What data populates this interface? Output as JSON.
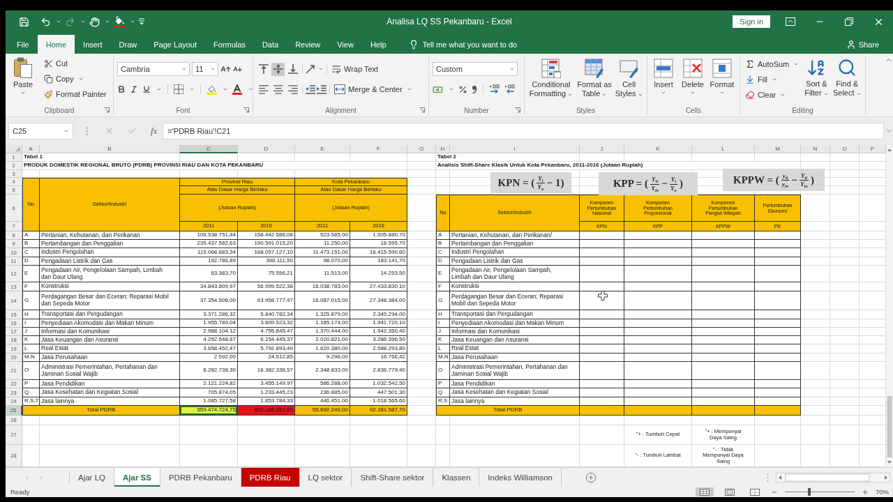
{
  "window": {
    "title": "Analisa LQ SS Pekanbaru - Excel",
    "sign_in": "Sign in"
  },
  "ribbon_tabs": [
    {
      "label": "File",
      "selected": false
    },
    {
      "label": "Home",
      "selected": true
    },
    {
      "label": "Insert",
      "selected": false
    },
    {
      "label": "Draw",
      "selected": false
    },
    {
      "label": "Page Layout",
      "selected": false
    },
    {
      "label": "Formulas",
      "selected": false
    },
    {
      "label": "Data",
      "selected": false
    },
    {
      "label": "Review",
      "selected": false
    },
    {
      "label": "View",
      "selected": false
    },
    {
      "label": "Help",
      "selected": false
    }
  ],
  "tell_me": {
    "placeholder": "Tell me what you want to do"
  },
  "share": "Share",
  "ribbon": {
    "clipboard": {
      "label": "Clipboard",
      "paste": "Paste",
      "cut": "Cut",
      "copy": "Copy",
      "format_painter": "Format Painter"
    },
    "font": {
      "label": "Font",
      "name": "Cambria",
      "size": "11"
    },
    "alignment": {
      "label": "Alignment",
      "vertical": [
        {
          "kind": "top",
          "selected": false
        },
        {
          "kind": "middle",
          "selected": true
        },
        {
          "kind": "bottom",
          "selected": false
        }
      ],
      "horizontal": [
        {
          "kind": "left",
          "selected": false
        },
        {
          "kind": "center",
          "selected": false
        },
        {
          "kind": "right",
          "selected": false
        }
      ],
      "wrap_text": "Wrap Text",
      "merge_center": "Merge & Center"
    },
    "number": {
      "label": "Number",
      "format": "Custom"
    },
    "styles": {
      "label": "Styles",
      "buttons": [
        {
          "kind": "conditional",
          "label": "Conditional Formatting"
        },
        {
          "kind": "table",
          "label": "Format as Table"
        },
        {
          "kind": "cell_styles",
          "label": "Cell Styles"
        }
      ]
    },
    "cells": {
      "label": "Cells",
      "buttons": [
        {
          "kind": "insert",
          "label": "Insert"
        },
        {
          "kind": "delete",
          "label": "Delete"
        },
        {
          "kind": "format",
          "label": "Format"
        }
      ]
    },
    "editing": {
      "label": "Editing",
      "autosum": "AutoSum",
      "fill": "Fill",
      "clear": "Clear",
      "sort_filter": "Sort & Filter",
      "find_select": "Find & Select"
    }
  },
  "formula_bar": {
    "name_box": "C25",
    "function_label": "fx",
    "formula": "='PDRB Riau'!C21"
  },
  "columns": [
    {
      "label": "A",
      "selected": false
    },
    {
      "label": "B",
      "selected": false
    },
    {
      "label": "C",
      "selected": true
    },
    {
      "label": "D",
      "selected": false
    },
    {
      "label": "E",
      "selected": false
    },
    {
      "label": "F",
      "selected": false
    },
    {
      "label": "G",
      "selected": false
    },
    {
      "label": "H",
      "selected": false
    },
    {
      "label": "I",
      "selected": false
    },
    {
      "label": "J",
      "selected": false
    },
    {
      "label": "K",
      "selected": false
    },
    {
      "label": "L",
      "selected": false
    },
    {
      "label": "M",
      "selected": false
    },
    {
      "label": "N",
      "selected": false
    },
    {
      "label": "O",
      "selected": false
    },
    {
      "label": "P",
      "selected": false
    }
  ],
  "rows": [
    {
      "label": "1",
      "selected": false
    },
    {
      "label": "2",
      "selected": false
    },
    {
      "label": "3",
      "selected": false
    },
    {
      "label": "4",
      "selected": false
    },
    {
      "label": "5",
      "selected": false
    },
    {
      "label": "6",
      "selected": false
    },
    {
      "label": "7",
      "selected": false
    },
    {
      "label": "8",
      "selected": false
    },
    {
      "label": "9",
      "selected": false
    },
    {
      "label": "10",
      "selected": false
    },
    {
      "label": "11",
      "selected": false
    },
    {
      "label": "12",
      "selected": false
    },
    {
      "label": "13",
      "selected": false
    },
    {
      "label": "14",
      "selected": false
    },
    {
      "label": "15",
      "selected": false
    },
    {
      "label": "16",
      "selected": false
    },
    {
      "label": "17",
      "selected": false
    },
    {
      "label": "18",
      "selected": false
    },
    {
      "label": "19",
      "selected": false
    },
    {
      "label": "20",
      "selected": false
    },
    {
      "label": "21",
      "selected": false
    },
    {
      "label": "22",
      "selected": false
    },
    {
      "label": "23",
      "selected": false
    },
    {
      "label": "24",
      "selected": false
    },
    {
      "label": "25",
      "selected": true
    },
    {
      "label": "26",
      "selected": false
    },
    {
      "label": "27",
      "selected": false
    },
    {
      "label": "28",
      "selected": false
    }
  ],
  "table_1": {
    "title": "Tabel 1",
    "subtitle": "PRODUK DOMESTIK REGIONAL BRUTO (PDRB) PROVINSI RIAU DAN KOTA PEKANBARU",
    "header": {
      "no": "No",
      "sector": "Sektor/Industri",
      "groups": [
        {
          "region": "Provinsi Riau",
          "basis": "Atas Dasar Harga Berlaku",
          "unit": "(Jutaan Rupiah)",
          "years": [
            "2011",
            "2016"
          ]
        },
        {
          "region": "Kota Pekanbaru",
          "basis": "Atas Dasar Harga Berlaku",
          "unit": "(Jutaan Rupiah)",
          "years": [
            "2011",
            "2016"
          ]
        }
      ]
    },
    "rows": [
      {
        "code": "A",
        "sector": "Pertanian, Kehutanan, dan Perikanan",
        "values": [
          "106.538.751,44",
          "158.442.586,08",
          "523.585,00",
          "1.505.880,70"
        ]
      },
      {
        "code": "B",
        "sector": "Pertambangan dan Penggalian",
        "values": [
          "235.437.582,63",
          "190.591.015,20",
          "11.250,00",
          "18.595,70"
        ]
      },
      {
        "code": "C",
        "sector": "Industri Pengolahan",
        "values": [
          "115.068.683,34",
          "168.057.127,10",
          "11.473.151,00",
          "16.415.590,60"
        ]
      },
      {
        "code": "D",
        "sector": "Pengadaan Listrik dan Gas",
        "values": [
          "192.786,89",
          "396.111,50",
          "98.070,00",
          "183.141,70"
        ]
      },
      {
        "code": "E",
        "sector": "Pengadaan Air, Pengelolaan Sampah, Limbah dan Daur Ulang",
        "values": [
          "63.383,70",
          "75.556,21",
          "11.513,00",
          "14.253,50"
        ]
      },
      {
        "code": "F",
        "sector": "Konstruksi",
        "values": [
          "34.843.609,97",
          "56.999.522,38",
          "16.038.783,00",
          "27.433.830,10"
        ]
      },
      {
        "code": "G",
        "sector": "Perdagangan Besar dan Eceran; Reparasi Mobil dan Sepeda Motor",
        "values": [
          "37.354.506,00",
          "63.958.777,47",
          "16.087.015,00",
          "27.348.384,00"
        ]
      },
      {
        "code": "H",
        "sector": "Transportasi dan Pergudangan",
        "values": [
          "3.371.286,32",
          "5.840.782,34",
          "1.325.879,00",
          "2.345.294,00"
        ]
      },
      {
        "code": "I",
        "sector": "Penyediaan Akomodasi dan Makan Minum",
        "values": [
          "1.955.789,04",
          "3.609.523,32",
          "1.185.174,00",
          "1.941.720,10"
        ]
      },
      {
        "code": "J",
        "sector": "Informasi dan Komunikasi",
        "values": [
          "2.988.104,12",
          "4.755.845,47",
          "1.370.444,00",
          "1.942.350,40"
        ]
      },
      {
        "code": "K",
        "sector": "Jasa Keuangan dan Asuransi",
        "values": [
          "4.252.648,67",
          "6.154.445,37",
          "2.020.821,00",
          "3.286.396,50"
        ]
      },
      {
        "code": "L",
        "sector": "Real Estat",
        "values": [
          "3.658.452,47",
          "5.792.893,49",
          "1.620.380,00",
          "2.588.293,80"
        ]
      },
      {
        "code": "M,N",
        "sector": "Jasa Perusahaan",
        "values": [
          "2.592,00",
          "24.512,85",
          "9.296,00",
          "16.756,42"
        ]
      },
      {
        "code": "O",
        "sector": "Administrasi Pemerintahan, Pertahanan dan Jaminan Sosial Wajib",
        "values": [
          "8.282.738,30",
          "16.382.336,57",
          "2.348.833,00",
          "2.836.779,40"
        ]
      },
      {
        "code": "P",
        "sector": "Jasa Pendidikan",
        "values": [
          "2.121.224,82",
          "3.455.149,97",
          "586.288,00",
          "1.032.542,50"
        ]
      },
      {
        "code": "Q",
        "sector": "Jasa Kesehatan dan Kegiatan Sosial",
        "values": [
          "705.874,05",
          "1.233.445,23",
          "236.885,00",
          "447.501,30"
        ]
      },
      {
        "code": "R,S,T",
        "sector": "Jasa lainnya",
        "values": [
          "1.085.727,58",
          "1.853.784,33",
          "446.451,00",
          "1.018.565,60"
        ]
      }
    ],
    "total": {
      "label": "Total PDRB",
      "cells": [
        {
          "value": "559.474.724,75",
          "color": "#e3f03c",
          "selected": true
        },
        {
          "value": "802.188.397,05",
          "color": "#e2141b",
          "selected": false
        },
        {
          "value": "55.692.240,00",
          "color": "#f5be00",
          "selected": false
        },
        {
          "value": "92.381.587,70",
          "color": "#f5be00",
          "selected": false
        }
      ]
    }
  },
  "table_2": {
    "title": "Tabel 2",
    "subtitle": "Analisis Shift-Share Klasik Untuk Kota Pekanbaru, 2011-2016 (Jutaan Rupiah)",
    "header": {
      "no": "No",
      "sector": "Sektor/Industri",
      "components": [
        {
          "name": "Komponen Pertumbuhan Nasional",
          "abbr": "KPN"
        },
        {
          "name": "Komponen Pertumbuhan Proporsional",
          "abbr": "KPP"
        },
        {
          "name": "Komponen Pertumbuhan Pangsa Wilayah",
          "abbr": "KPPW"
        },
        {
          "name": "Pertumbuhan Ekonomi",
          "abbr": "PE"
        }
      ]
    },
    "rows": [
      {
        "code": "A",
        "sector": "Pertanian, Kehutanan, dan Perikanan/"
      },
      {
        "code": "B",
        "sector": "Pertambangan dan Penggalian"
      },
      {
        "code": "C",
        "sector": "Industri Pengolahan"
      },
      {
        "code": "D",
        "sector": "Pengadaan Listrik dan Gas"
      },
      {
        "code": "E",
        "sector": "Pengadaan Air, Pengelolaan Sampah, Limbah dan Daur Ulang"
      },
      {
        "code": "F",
        "sector": "Konstruksi"
      },
      {
        "code": "G",
        "sector": "Perdagangan Besar dan Eceran; Reparasi Mobil dan Sepeda Motor"
      },
      {
        "code": "H",
        "sector": "Transportasi dan Pergudangan"
      },
      {
        "code": "I",
        "sector": "Penyediaan Akomodasi dan Makan Minum"
      },
      {
        "code": "J",
        "sector": "Informasi dan Komunikasi"
      },
      {
        "code": "K",
        "sector": "Jasa Keuangan dan Asuransi"
      },
      {
        "code": "L",
        "sector": "Real Estat"
      },
      {
        "code": "M,N",
        "sector": "Jasa Perusahaan"
      },
      {
        "code": "O",
        "sector": "Administrasi Pemerintahan, Pertahanan dan Jaminan Sosial Wajib"
      },
      {
        "code": "P",
        "sector": "Jasa Pendidikan"
      },
      {
        "code": "Q",
        "sector": "Jasa Kesehatan dan Kegiatan Sosial"
      },
      {
        "code": "R,S",
        "sector": "Jasa lainnya"
      }
    ],
    "total": {
      "label": "Total PDRB"
    }
  },
  "equations": [
    {
      "tokens": [
        {
          "kind": "text",
          "text": "KPN = ("
        },
        {
          "kind": "fraction",
          "num": "Y$_{t}$",
          "den": "Y$_{o}$"
        },
        {
          "kind": "text",
          "text": "− 1)"
        }
      ]
    },
    {
      "tokens": [
        {
          "kind": "text",
          "text": "KPP = ("
        },
        {
          "kind": "fraction",
          "num": "Y$_{it}$",
          "den": "Y$_{io}$"
        },
        {
          "kind": "text",
          "text": "−"
        },
        {
          "kind": "fraction",
          "num": "Y$_{t}$",
          "den": "Y$_{o}$"
        },
        {
          "kind": "text",
          "text": ")"
        }
      ]
    },
    {
      "tokens": [
        {
          "kind": "text",
          "text": "KPPW = ("
        },
        {
          "kind": "fraction",
          "num": "y$_{it}$",
          "den": "y$_{io}$"
        },
        {
          "kind": "text",
          "text": "−"
        },
        {
          "kind": "fraction",
          "num": "Y$_{it}$",
          "den": "Y$_{io}$"
        },
        {
          "kind": "text",
          "text": ")"
        }
      ]
    }
  ],
  "legend": [
    [
      "\"+ : Tumbuh Cepat",
      "\"+ : Mempunyai Daya Saing"
    ],
    [
      "\"- : Tumbuh Lambat",
      "\"- : Tidak Mempunyai Daya Saing"
    ]
  ],
  "sheet_tabs": [
    {
      "label": "Ajar LQ",
      "selected": false
    },
    {
      "label": "Ajar SS",
      "selected": true
    },
    {
      "label": "PDRB Pekanbaru",
      "selected": false
    },
    {
      "label": "PDRB Riau",
      "selected": false,
      "color": "#c40000"
    },
    {
      "label": "LQ sektor",
      "selected": false
    },
    {
      "label": "Shift-Share sektor",
      "selected": false
    },
    {
      "label": "Klassen",
      "selected": false
    },
    {
      "label": "Indeks Williamson",
      "selected": false
    }
  ],
  "status_bar": {
    "status": "Ready",
    "views": [
      {
        "kind": "normal",
        "selected": true
      },
      {
        "kind": "page_layout",
        "selected": false
      },
      {
        "kind": "page_break",
        "selected": false
      }
    ],
    "zoom": {
      "level": 0.35,
      "label": "70%"
    }
  }
}
